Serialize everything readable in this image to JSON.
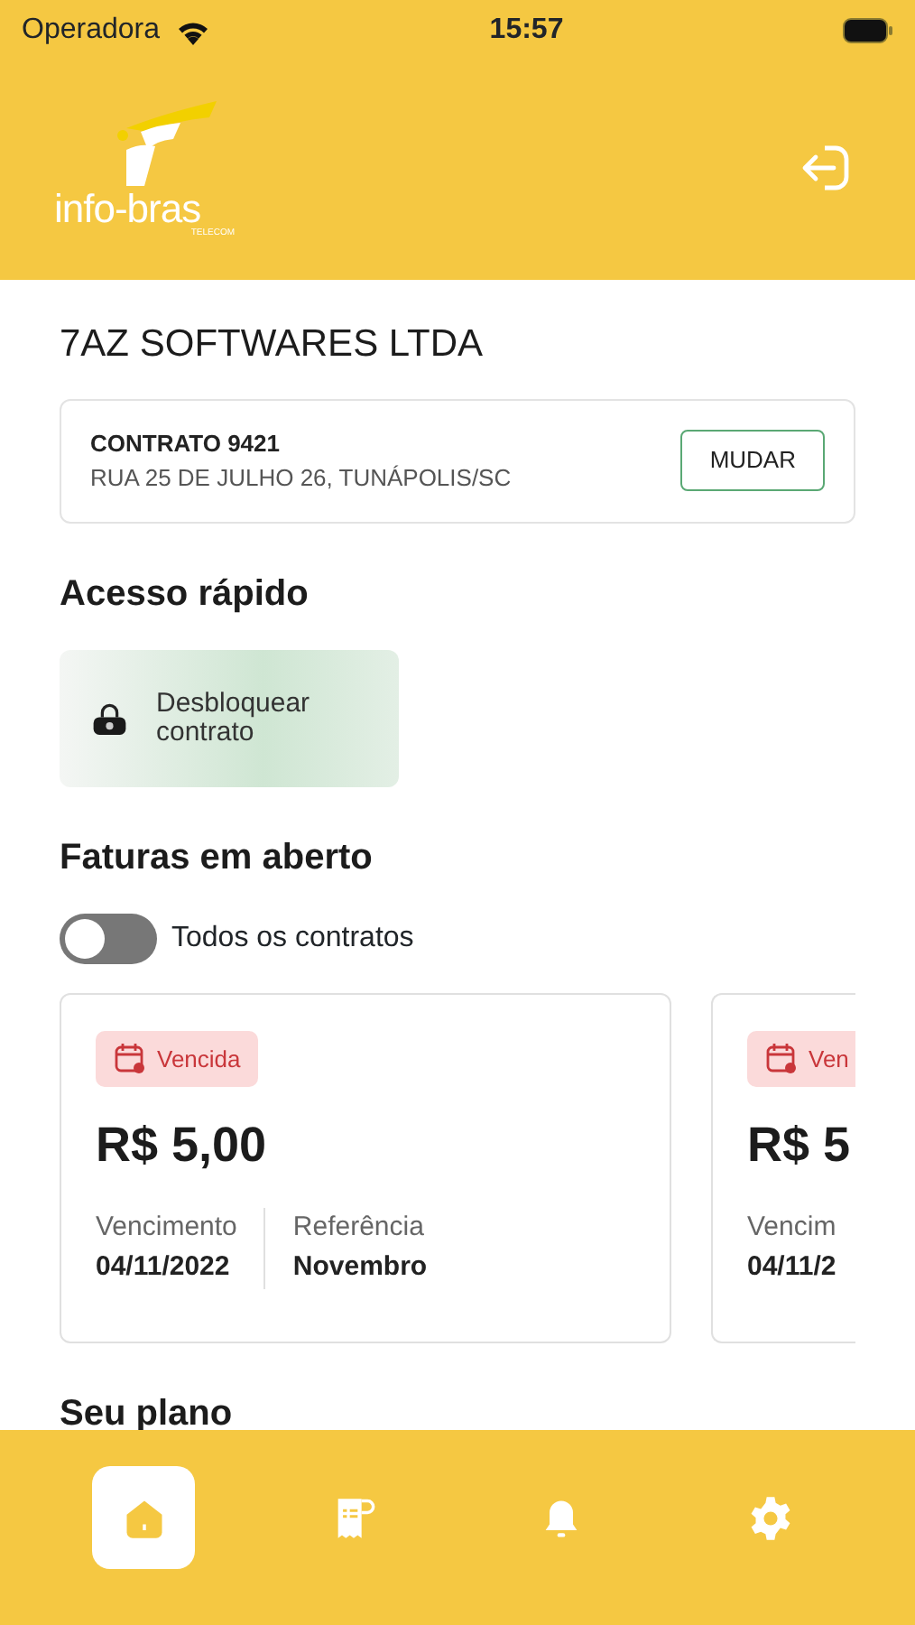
{
  "status_bar": {
    "carrier": "Operadora",
    "time": "15:57"
  },
  "header": {
    "logo": {
      "name": "info-bras",
      "tagline": "TELECOM"
    }
  },
  "company": "7AZ SOFTWARES LTDA",
  "contract": {
    "title": "CONTRATO 9421",
    "address": "RUA 25 DE JULHO 26, TUNÁPOLIS/SC",
    "button": "MUDAR"
  },
  "quick_access": {
    "title": "Acesso rápido",
    "items": [
      {
        "label": "Desbloquear contrato"
      }
    ]
  },
  "open_invoices": {
    "title": "Faturas em aberto",
    "toggle": {
      "label": "Todos os contratos",
      "on": false
    },
    "invoices": [
      {
        "kind": "overdue",
        "badge": "Vencida",
        "amount": "R$ 5,00",
        "due_label": "Vencimento",
        "due_date": "04/11/2022",
        "ref_label": "Referência",
        "ref_value": "Novembro"
      },
      {
        "kind": "overdue",
        "badge": "Ven",
        "amount": "R$ 5",
        "due_label": "Vencim",
        "due_date": "04/11/2"
      }
    ]
  },
  "plan": {
    "title": "Seu plano"
  },
  "bottom_nav": [
    {
      "kind": "home",
      "selected": true
    },
    {
      "kind": "invoices",
      "selected": false
    },
    {
      "kind": "notifications",
      "selected": false
    },
    {
      "kind": "settings",
      "selected": false
    }
  ]
}
